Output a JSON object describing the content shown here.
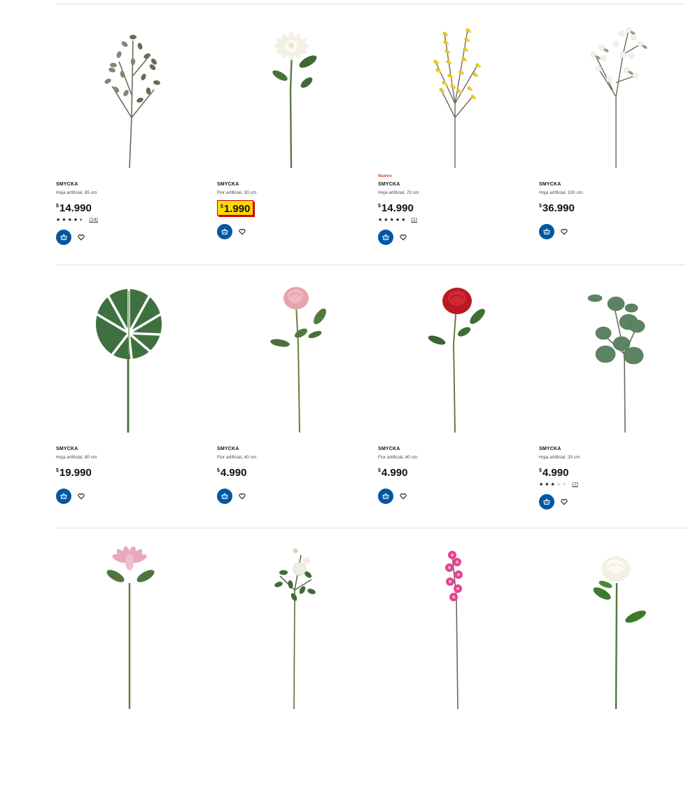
{
  "colors": {
    "accent": "#0058a3",
    "new_tag": "#c7531d",
    "price_highlight": "#ffdb00",
    "price_highlight_border": "#cc0008"
  },
  "products": [
    {
      "brand": "SMYCKA",
      "desc": "Hoja artificial, 65 cm",
      "currency": "$",
      "price": "14.990",
      "rating": {
        "stars": 4.5,
        "count": "(14)"
      },
      "image": "eucalyptus-branch"
    },
    {
      "brand": "SMYCKA",
      "desc": "Flor artificial, 30 cm",
      "currency": "$",
      "price": "1.990",
      "highlight": true,
      "image": "white-dahlia"
    },
    {
      "tag": "Nuevo",
      "brand": "SMYCKA",
      "desc": "Hoja artificial, 70 cm",
      "currency": "$",
      "price": "14.990",
      "rating": {
        "stars": 5,
        "count": "(1)"
      },
      "image": "yellow-forsythia"
    },
    {
      "brand": "SMYCKA",
      "desc": "Hoja artificial, 100 cm",
      "currency": "$",
      "price": "36.990",
      "image": "white-blossom-branch"
    },
    {
      "brand": "SMYCKA",
      "desc": "Hoja artificial, 80 cm",
      "currency": "$",
      "price": "19.990",
      "image": "monstera-leaf"
    },
    {
      "brand": "SMYCKA",
      "desc": "Flor artificial, 40 cm",
      "currency": "$",
      "price": "4.990",
      "image": "pink-rose"
    },
    {
      "brand": "SMYCKA",
      "desc": "Flor artificial, 40 cm",
      "currency": "$",
      "price": "4.990",
      "image": "red-rose"
    },
    {
      "brand": "SMYCKA",
      "desc": "Hoja artificial, 29 cm",
      "currency": "$",
      "price": "4.990",
      "rating": {
        "stars": 3,
        "count": "(7)"
      },
      "image": "eucalyptus-stem"
    },
    {
      "image": "pink-lotus"
    },
    {
      "image": "white-rose-spray"
    },
    {
      "image": "pink-orchid"
    },
    {
      "image": "white-peony"
    }
  ]
}
